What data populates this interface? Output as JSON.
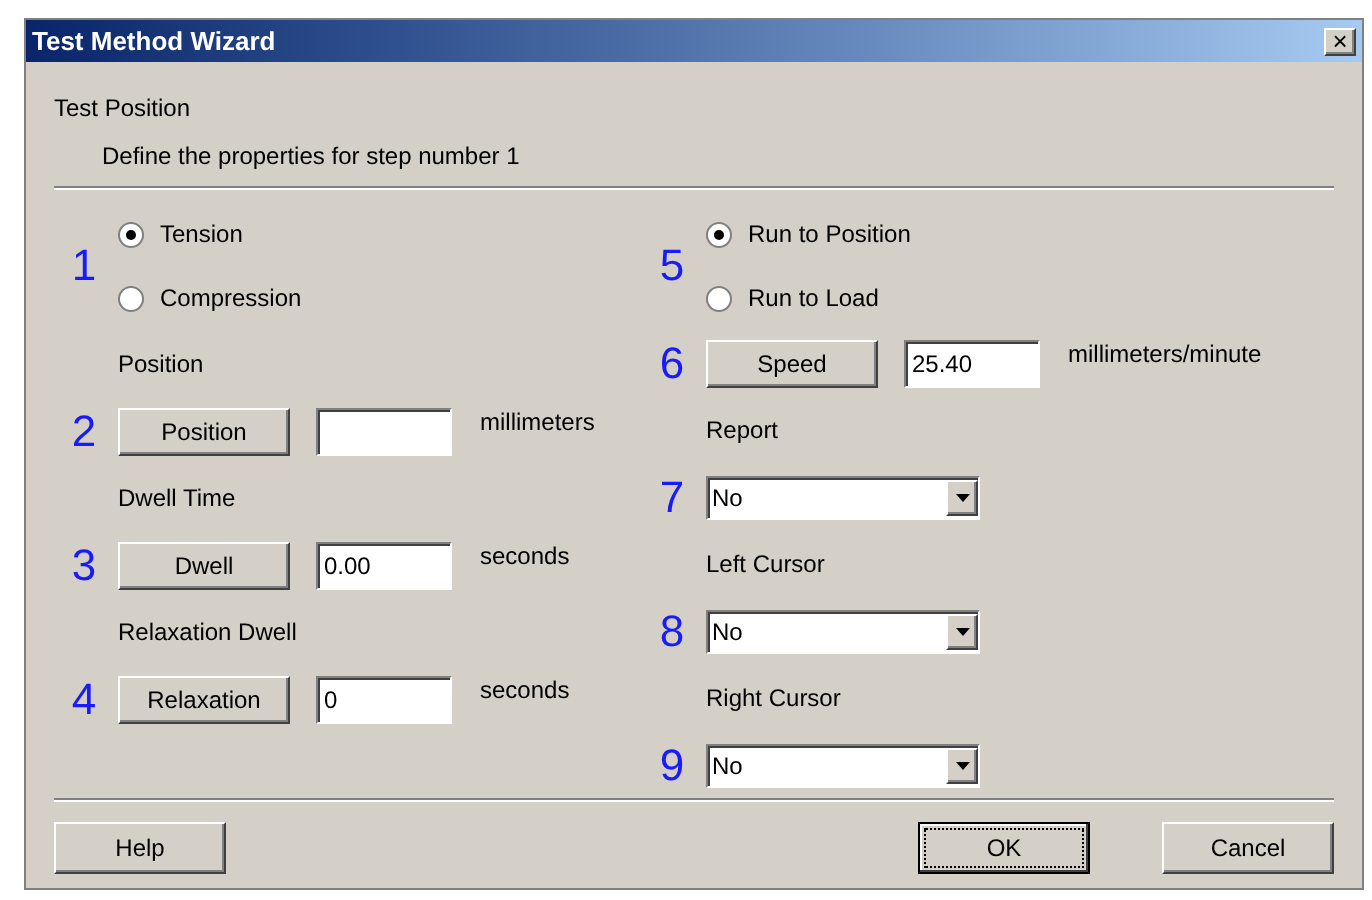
{
  "window": {
    "title": "Test Method Wizard",
    "close": "×"
  },
  "header": {
    "title": "Test Position",
    "subtitle": "Define the properties for step number 1"
  },
  "columns": [
    {
      "sections": [
        {
          "kind": "radio",
          "number": "1",
          "options": [
            {
              "label": "Tension",
              "selected": true
            },
            {
              "label": "Compression",
              "selected": false
            }
          ]
        },
        {
          "kind": "button_field",
          "number": "2",
          "label": "Position",
          "button": "Position",
          "unit": "millimeters"
        },
        {
          "kind": "button_field",
          "number": "3",
          "label": "Dwell Time",
          "button": "Dwell",
          "value": "0.00",
          "unit": "seconds"
        },
        {
          "kind": "button_field",
          "number": "4",
          "label": "Relaxation Dwell",
          "button": "Relaxation",
          "value": "0",
          "unit": "seconds"
        }
      ]
    },
    {
      "sections": [
        {
          "kind": "radio",
          "number": "5",
          "options": [
            {
              "label": "Run to Position",
              "selected": true
            },
            {
              "label": "Run to Load",
              "selected": false
            }
          ]
        },
        {
          "kind": "button_field",
          "number": "6",
          "button": "Speed",
          "value": "25.40",
          "unit": "millimeters/minute"
        },
        {
          "kind": "select",
          "number": "7",
          "label": "Report",
          "value": "No"
        },
        {
          "kind": "select",
          "number": "8",
          "label": "Left Cursor",
          "value": "No"
        },
        {
          "kind": "select",
          "number": "9",
          "label": "Right Cursor",
          "value": "No"
        }
      ]
    }
  ],
  "footer": {
    "buttons": [
      {
        "label": "Help",
        "default": false
      },
      {
        "label": "OK",
        "default": true
      },
      {
        "label": "Cancel",
        "default": false
      }
    ]
  }
}
